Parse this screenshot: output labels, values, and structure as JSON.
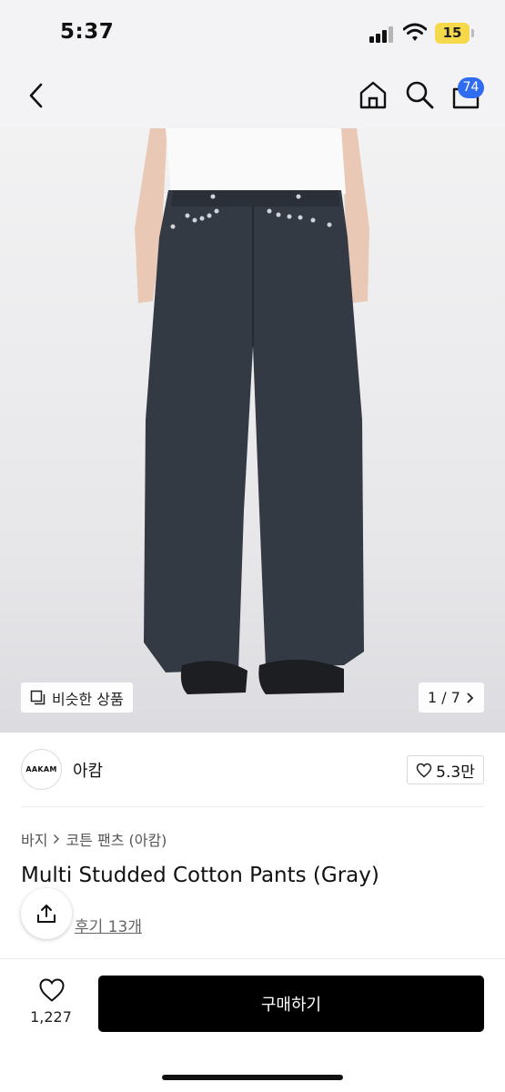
{
  "status_bar": {
    "time": "5:37",
    "battery": "15"
  },
  "header": {
    "cart_count": "74"
  },
  "image": {
    "similar_label": "비슷한 상품",
    "counter": "1 / 7"
  },
  "brand": {
    "logo_text": "AAKAM",
    "name": "아캄",
    "likes": "5.3만"
  },
  "product": {
    "breadcrumb": [
      "바지",
      "코튼 팬츠 (아캄)"
    ],
    "title": "Multi Studded Cotton Pants (Gray)",
    "reviews": "후기 13개"
  },
  "bottom": {
    "wish_count": "1,227",
    "buy_label": "구매하기"
  },
  "colors": {
    "badge": "#2f6cf0",
    "battery": "#f5d94a",
    "buy_button": "#000000"
  },
  "icons": [
    "back-icon",
    "home-icon",
    "search-icon",
    "shopping-bag-icon",
    "copy-icon",
    "chevron-right-icon",
    "heart-icon",
    "share-icon"
  ]
}
